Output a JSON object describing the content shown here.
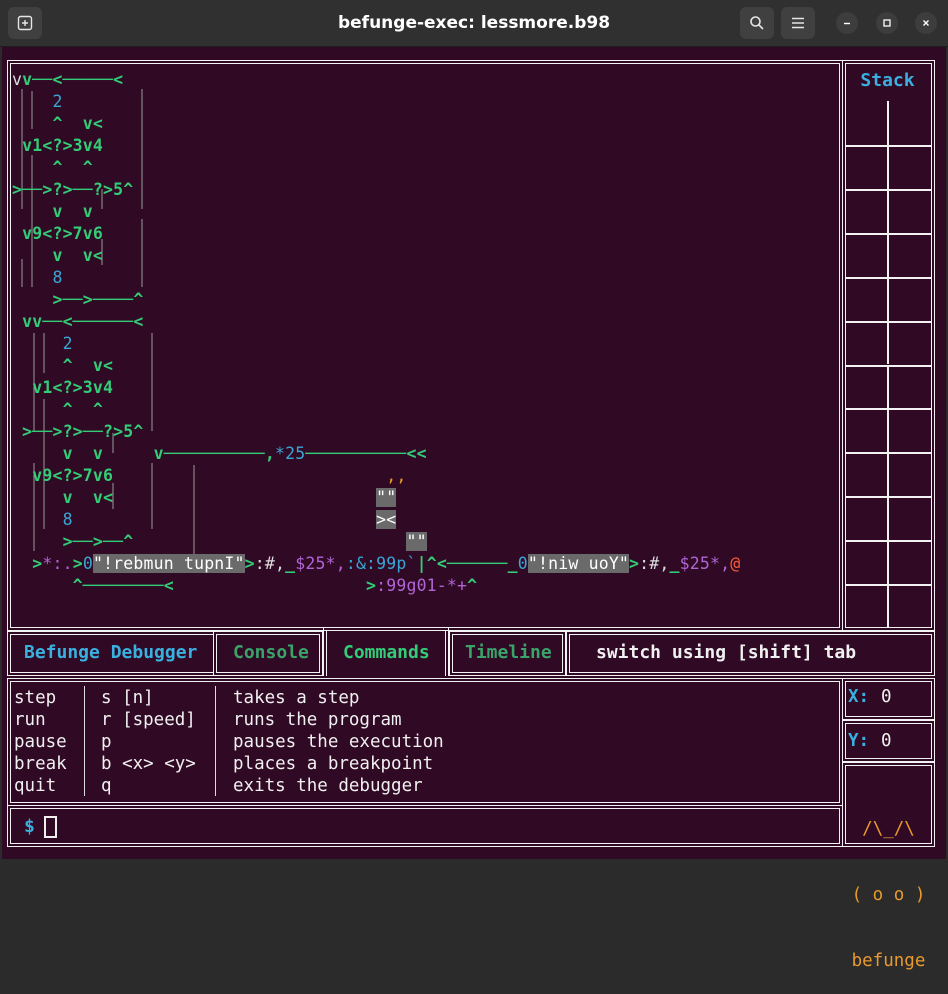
{
  "window": {
    "title": "befunge-exec: lessmore.b98"
  },
  "code": {
    "lines": [
      [
        [
          "v",
          "w"
        ],
        [
          "v",
          "g"
        ],
        [
          "──<─────<",
          "g"
        ]
      ],
      [
        [
          "    2",
          "b"
        ]
      ],
      [
        [
          "    ^  v<",
          "g"
        ]
      ],
      [
        [
          " v1<?>3v4",
          "g"
        ]
      ],
      [
        [
          "    ^  ^",
          "g"
        ]
      ],
      [
        [
          ">──>?>──?>5^",
          "g"
        ]
      ],
      [
        [
          "    v  v",
          "g"
        ]
      ],
      [
        [
          " v9<?>7v6",
          "g"
        ]
      ],
      [
        [
          "    v  v<",
          "g"
        ]
      ],
      [
        [
          "    8",
          "b"
        ]
      ],
      [
        [
          "    >──>────^",
          "g"
        ]
      ],
      [
        [
          " vv──<──────<",
          "g"
        ]
      ],
      [
        [
          "     2",
          "b"
        ]
      ],
      [
        [
          "     ^  v<",
          "g"
        ]
      ],
      [
        [
          "  v1<?>3v4",
          "g"
        ]
      ],
      [
        [
          "     ^  ^",
          "g"
        ]
      ],
      [
        [
          " >──>?>──?>5^",
          "g"
        ]
      ],
      [
        [
          "     v  v",
          "g"
        ],
        [
          "     v──────────,",
          "g"
        ],
        [
          "*25",
          "b"
        ],
        [
          "──────────<<",
          "g"
        ]
      ],
      [
        [
          "  v9<?>7v6",
          "g"
        ],
        [
          "                           ,,",
          "o"
        ]
      ],
      [
        [
          "     v  v<",
          "g"
        ],
        [
          "                          ",
          "w"
        ],
        [
          "\"\"",
          "sel"
        ]
      ],
      [
        [
          "     8",
          "b"
        ],
        [
          "                              ",
          "w"
        ],
        [
          "><",
          "sel"
        ]
      ],
      [
        [
          "     >──>──^",
          "g"
        ],
        [
          "                           ",
          "w"
        ],
        [
          "\"\"",
          "sel"
        ]
      ],
      [
        [
          "  >",
          "g"
        ],
        [
          "*:.",
          "m"
        ],
        [
          ">",
          "g"
        ],
        [
          "0",
          "b"
        ],
        [
          "\"!rebmun tupnI\"",
          "sel"
        ],
        [
          ">",
          "g"
        ],
        [
          ":#,",
          "w"
        ],
        [
          "_",
          "g"
        ],
        [
          "$25*,",
          "m"
        ],
        [
          ":&:99p`",
          "b"
        ],
        [
          "|",
          "g"
        ],
        [
          "^<──────_",
          "g"
        ],
        [
          "0",
          "b"
        ],
        [
          "\"!niw uoY\"",
          "sel"
        ],
        [
          ">",
          "g"
        ],
        [
          ":#,",
          "w"
        ],
        [
          "_",
          "g"
        ],
        [
          "$25*,",
          "m"
        ],
        [
          "@",
          "r"
        ]
      ],
      [
        [
          "      ^────────<",
          "g"
        ],
        [
          "                   >",
          "g"
        ],
        [
          ":99g01-*+",
          "m"
        ],
        [
          "^",
          "g"
        ]
      ]
    ]
  },
  "stack": {
    "title": "Stack",
    "rows": 12
  },
  "tabs": [
    {
      "label": "Befunge Debugger",
      "color": "#3ab0e0"
    },
    {
      "label": "Console",
      "color": "#3aa36a"
    },
    {
      "label": "Commands",
      "color": "#33cc77",
      "active": true
    },
    {
      "label": "Timeline",
      "color": "#3aa36a"
    }
  ],
  "hint": "switch using [shift] tab",
  "commands": [
    {
      "name": "step",
      "key": "s [n]",
      "desc": "takes a step"
    },
    {
      "name": "run",
      "key": "r [speed]",
      "desc": "runs the program"
    },
    {
      "name": "pause",
      "key": "p",
      "desc": "pauses the execution"
    },
    {
      "name": "break",
      "key": "b <x> <y>",
      "desc": "places a breakpoint"
    },
    {
      "name": "quit",
      "key": "q",
      "desc": "exits the debugger"
    }
  ],
  "position": {
    "x_label": "X:",
    "x": "0",
    "y_label": "Y:",
    "y": "0"
  },
  "logo": {
    "line1": "/\\_/\\",
    "line2": "( o o )",
    "line3": "befunge"
  },
  "prompt": {
    "symbol": "$"
  }
}
